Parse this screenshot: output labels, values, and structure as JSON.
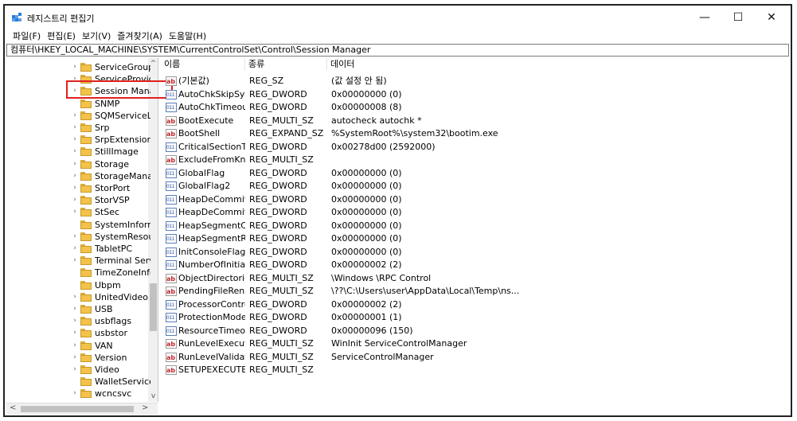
{
  "window": {
    "title": "레지스트리 편집기",
    "minimize": "—",
    "maximize": "☐",
    "close": "✕"
  },
  "menu": [
    "파일(F)",
    "편집(E)",
    "보기(V)",
    "즐겨찾기(A)",
    "도움말(H)"
  ],
  "address": "컴퓨터\\HKEY_LOCAL_MACHINE\\SYSTEM\\CurrentControlSet\\Control\\Session Manager",
  "tree": {
    "items": [
      {
        "label": "ServiceGroupO",
        "expand": "›"
      },
      {
        "label": "ServiceProvide",
        "expand": "›"
      },
      {
        "label": "Session Manag",
        "expand": "›",
        "selected": true
      },
      {
        "label": "SNMP",
        "expand": ""
      },
      {
        "label": "SQMServiceLis",
        "expand": "›"
      },
      {
        "label": "Srp",
        "expand": "›"
      },
      {
        "label": "SrpExtensionC",
        "expand": "›"
      },
      {
        "label": "StillImage",
        "expand": "›"
      },
      {
        "label": "Storage",
        "expand": "›"
      },
      {
        "label": "StorageManag",
        "expand": "›"
      },
      {
        "label": "StorPort",
        "expand": "›"
      },
      {
        "label": "StorVSP",
        "expand": "›"
      },
      {
        "label": "StSec",
        "expand": "›"
      },
      {
        "label": "SystemInforma",
        "expand": ""
      },
      {
        "label": "SystemResourc",
        "expand": "›"
      },
      {
        "label": "TabletPC",
        "expand": "›"
      },
      {
        "label": "Terminal Serve",
        "expand": "›"
      },
      {
        "label": "TimeZoneInfor",
        "expand": ""
      },
      {
        "label": "Ubpm",
        "expand": ""
      },
      {
        "label": "UnitedVideo",
        "expand": "›"
      },
      {
        "label": "USB",
        "expand": "›"
      },
      {
        "label": "usbflags",
        "expand": "›"
      },
      {
        "label": "usbstor",
        "expand": "›"
      },
      {
        "label": "VAN",
        "expand": "›"
      },
      {
        "label": "Version",
        "expand": "›"
      },
      {
        "label": "Video",
        "expand": "›"
      },
      {
        "label": "WalletService",
        "expand": ""
      },
      {
        "label": "wcncsvc",
        "expand": "›"
      }
    ],
    "scroll_up": "^",
    "scroll_down": "v",
    "scroll_left": "<",
    "scroll_right": ">"
  },
  "columns": {
    "name": "이름",
    "type": "종류",
    "data": "데이터"
  },
  "values": [
    {
      "name": "(기본값)",
      "type": "REG_SZ",
      "data": "(값 설정 안 됨)",
      "icon": "string-value-icon"
    },
    {
      "name": "AutoChkSkipSys...",
      "type": "REG_DWORD",
      "data": "0x00000000 (0)",
      "icon": "dword-value-icon"
    },
    {
      "name": "AutoChkTimeout",
      "type": "REG_DWORD",
      "data": "0x00000008 (8)",
      "icon": "dword-value-icon"
    },
    {
      "name": "BootExecute",
      "type": "REG_MULTI_SZ",
      "data": "autocheck autochk *",
      "icon": "string-value-icon"
    },
    {
      "name": "BootShell",
      "type": "REG_EXPAND_SZ",
      "data": "%SystemRoot%\\system32\\bootim.exe",
      "icon": "string-value-icon"
    },
    {
      "name": "CriticalSectionTi...",
      "type": "REG_DWORD",
      "data": "0x00278d00 (2592000)",
      "icon": "dword-value-icon"
    },
    {
      "name": "ExcludeFromKno...",
      "type": "REG_MULTI_SZ",
      "data": "",
      "icon": "string-value-icon"
    },
    {
      "name": "GlobalFlag",
      "type": "REG_DWORD",
      "data": "0x00000000 (0)",
      "icon": "dword-value-icon"
    },
    {
      "name": "GlobalFlag2",
      "type": "REG_DWORD",
      "data": "0x00000000 (0)",
      "icon": "dword-value-icon"
    },
    {
      "name": "HeapDeCommit...",
      "type": "REG_DWORD",
      "data": "0x00000000 (0)",
      "icon": "dword-value-icon"
    },
    {
      "name": "HeapDeCommit...",
      "type": "REG_DWORD",
      "data": "0x00000000 (0)",
      "icon": "dword-value-icon"
    },
    {
      "name": "HeapSegmentC...",
      "type": "REG_DWORD",
      "data": "0x00000000 (0)",
      "icon": "dword-value-icon"
    },
    {
      "name": "HeapSegmentRe...",
      "type": "REG_DWORD",
      "data": "0x00000000 (0)",
      "icon": "dword-value-icon"
    },
    {
      "name": "InitConsoleFlags",
      "type": "REG_DWORD",
      "data": "0x00000000 (0)",
      "icon": "dword-value-icon"
    },
    {
      "name": "NumberOfInitial...",
      "type": "REG_DWORD",
      "data": "0x00000002 (2)",
      "icon": "dword-value-icon"
    },
    {
      "name": "ObjectDirectories",
      "type": "REG_MULTI_SZ",
      "data": "\\Windows \\RPC Control",
      "icon": "string-value-icon"
    },
    {
      "name": "PendingFileRen...",
      "type": "REG_MULTI_SZ",
      "data": "\\??\\C:\\Users\\user\\AppData\\Local\\Temp\\ns...",
      "icon": "string-value-icon"
    },
    {
      "name": "ProcessorControl",
      "type": "REG_DWORD",
      "data": "0x00000002 (2)",
      "icon": "dword-value-icon"
    },
    {
      "name": "ProtectionMode",
      "type": "REG_DWORD",
      "data": "0x00000001 (1)",
      "icon": "dword-value-icon"
    },
    {
      "name": "ResourceTimeou...",
      "type": "REG_DWORD",
      "data": "0x00000096 (150)",
      "icon": "dword-value-icon"
    },
    {
      "name": "RunLevelExecute",
      "type": "REG_MULTI_SZ",
      "data": "WinInit ServiceControlManager",
      "icon": "string-value-icon"
    },
    {
      "name": "RunLevelValidate",
      "type": "REG_MULTI_SZ",
      "data": "ServiceControlManager",
      "icon": "string-value-icon"
    },
    {
      "name": "SETUPEXECUTE",
      "type": "REG_MULTI_SZ",
      "data": "",
      "icon": "string-value-icon"
    }
  ],
  "colors": {
    "highlight_box": "#e02020",
    "folder": "#f3c24a"
  }
}
